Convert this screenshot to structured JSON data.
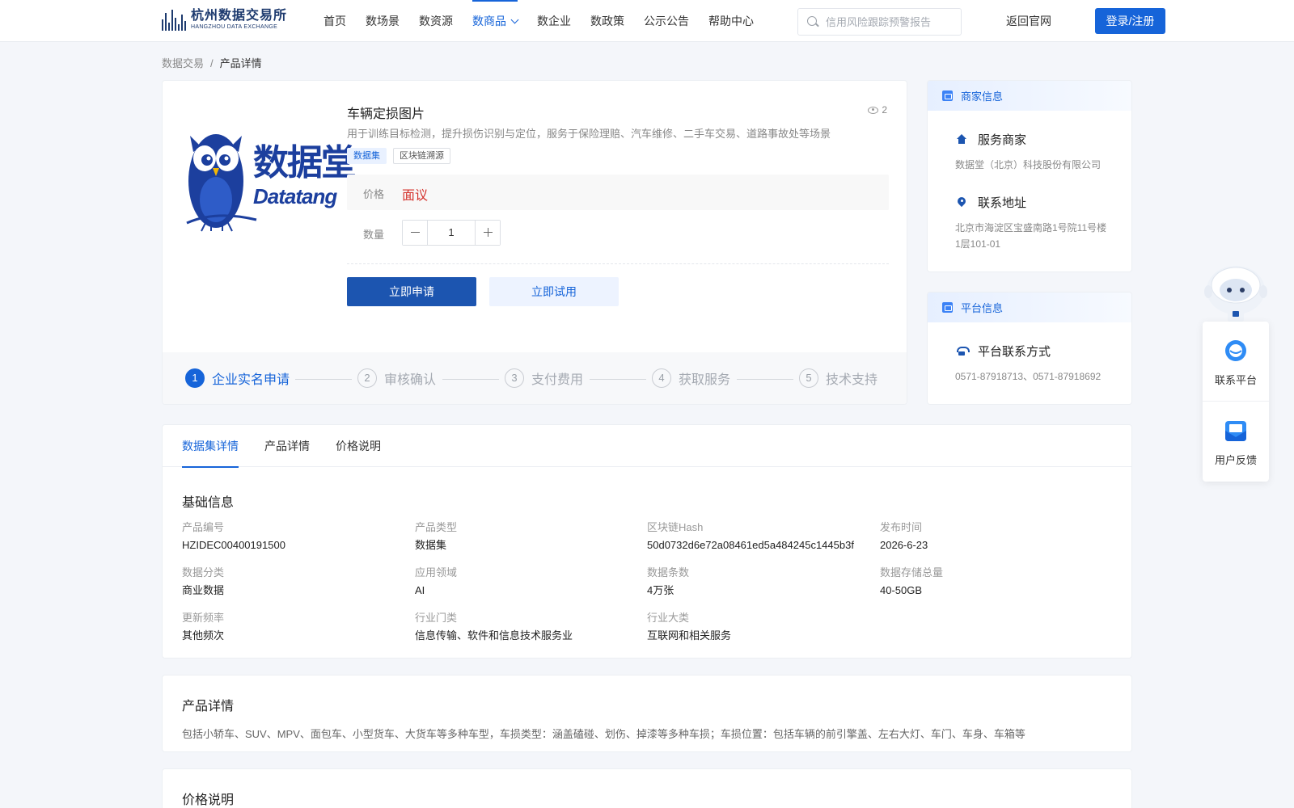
{
  "header": {
    "logo_cn": "杭州数据交易所",
    "logo_en": "HANGZHOU DATA EXCHANGE",
    "nav": [
      {
        "label": "首页",
        "active": false
      },
      {
        "label": "数场景",
        "active": false
      },
      {
        "label": "数资源",
        "active": false
      },
      {
        "label": "数商品",
        "active": true
      },
      {
        "label": "数企业",
        "active": false
      },
      {
        "label": "数政策",
        "active": false
      },
      {
        "label": "公示公告",
        "active": false
      },
      {
        "label": "帮助中心",
        "active": false
      }
    ],
    "search_placeholder": "信用风险跟踪预警报告",
    "back_label": "返回官网",
    "login_label": "登录/注册"
  },
  "breadcrumb": {
    "items": [
      "数据交易",
      "产品详情"
    ],
    "separator": "/"
  },
  "product": {
    "logo_cn": "数据堂",
    "logo_en": "Datatang",
    "title": "车辆定损图片",
    "views": "2",
    "description": "用于训练目标检测，提升损伤识别与定位，服务于保险理赔、汽车维修、二手车交易、道路事故处等场景",
    "tags": [
      "数据集",
      "区块链溯源"
    ],
    "price_label": "价格",
    "price_value": "面议",
    "qty_label": "数量",
    "qty_value": "1",
    "apply_label": "立即申请",
    "trial_label": "立即试用",
    "steps": [
      {
        "num": "1",
        "label": "企业实名申请",
        "active": true
      },
      {
        "num": "2",
        "label": "审核确认",
        "active": false
      },
      {
        "num": "3",
        "label": "支付费用",
        "active": false
      },
      {
        "num": "4",
        "label": "获取服务",
        "active": false
      },
      {
        "num": "5",
        "label": "技术支持",
        "active": false
      }
    ]
  },
  "merchant": {
    "header": "商家信息",
    "service_label": "服务商家",
    "service_value": "数据堂（北京）科技股份有限公司",
    "address_label": "联系地址",
    "address_value": "北京市海淀区宝盛南路1号院11号楼1层101-01"
  },
  "platform": {
    "header": "平台信息",
    "contact_label": "平台联系方式",
    "contact_value": "0571-87918713、0571-87918692"
  },
  "float": {
    "contact_label": "联系平台",
    "feedback_label": "用户反馈"
  },
  "tabs": [
    {
      "label": "数据集详情",
      "active": true
    },
    {
      "label": "产品详情",
      "active": false
    },
    {
      "label": "价格说明",
      "active": false
    }
  ],
  "basic": {
    "title": "基础信息",
    "fields": [
      {
        "label": "产品编号",
        "value": "HZIDEC00400191500"
      },
      {
        "label": "产品类型",
        "value": "数据集"
      },
      {
        "label": "区块链Hash",
        "value": "50d0732d6e72a08461ed5a484245c1445b3f"
      },
      {
        "label": "发布时间",
        "value": "2026-6-23"
      },
      {
        "label": "数据分类",
        "value": "商业数据"
      },
      {
        "label": "应用领域",
        "value": "AI"
      },
      {
        "label": "数据条数",
        "value": "4万张"
      },
      {
        "label": "数据存储总量",
        "value": "40-50GB"
      },
      {
        "label": "更新频率",
        "value": "其他频次"
      },
      {
        "label": "行业门类",
        "value": "信息传输、软件和信息技术服务业"
      },
      {
        "label": "行业大类",
        "value": "互联网和相关服务"
      }
    ]
  },
  "product_detail": {
    "title": "产品详情",
    "text": "包括小轿车、SUV、MPV、面包车、小型货车、大货车等多种车型，车损类型：涵盖磕碰、划伤、掉漆等多种车损；车损位置：包括车辆的前引擎盖、左右大灯、车门、车身、车箱等"
  },
  "price_note": {
    "title": "价格说明"
  },
  "colors": {
    "primary": "#1664d9",
    "dark_blue": "#1c55b0",
    "price_red": "#d4322c",
    "background": "#f4f6fa"
  }
}
